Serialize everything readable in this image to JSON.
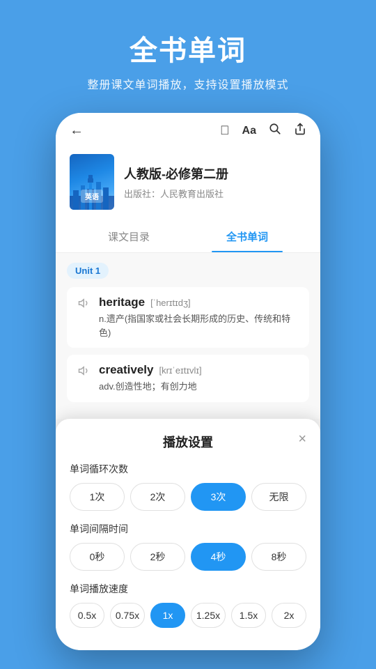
{
  "page": {
    "background_color": "#4A9FE8",
    "main_title": "全书单词",
    "subtitle": "整册课文单词播放，支持设置播放模式"
  },
  "phone": {
    "topbar": {
      "back_icon": "←",
      "icons": [
        "⊡",
        "Aa",
        "🔍",
        "⤴"
      ]
    },
    "book": {
      "title": "人教版-必修第二册",
      "publisher": "出版社：人民教育出版社",
      "cover_label": "英语"
    },
    "tabs": [
      {
        "label": "课文目录",
        "active": false
      },
      {
        "label": "全书单词",
        "active": true
      }
    ],
    "unit_badge": "Unit 1",
    "words": [
      {
        "word": "heritage",
        "phonetic": "[ˈherɪtɪdʒ]",
        "definition": "n.遗产(指国家或社会长期形成的历史、传统和特色)"
      },
      {
        "word": "creatively",
        "phonetic": "[krɪˈeɪtɪvlɪ]",
        "definition": "adv.创造性地；有创力地"
      }
    ]
  },
  "bottom_sheet": {
    "title": "播放设置",
    "close_icon": "×",
    "sections": [
      {
        "label": "单词循环次数",
        "options": [
          "1次",
          "2次",
          "3次",
          "无限"
        ],
        "active_index": 2
      },
      {
        "label": "单词间隔时间",
        "options": [
          "0秒",
          "2秒",
          "4秒",
          "8秒"
        ],
        "active_index": 2
      },
      {
        "label": "单词播放速度",
        "options": [
          "0.5x",
          "0.75x",
          "1x",
          "1.25x",
          "1.5x",
          "2x"
        ],
        "active_index": 2
      }
    ]
  }
}
